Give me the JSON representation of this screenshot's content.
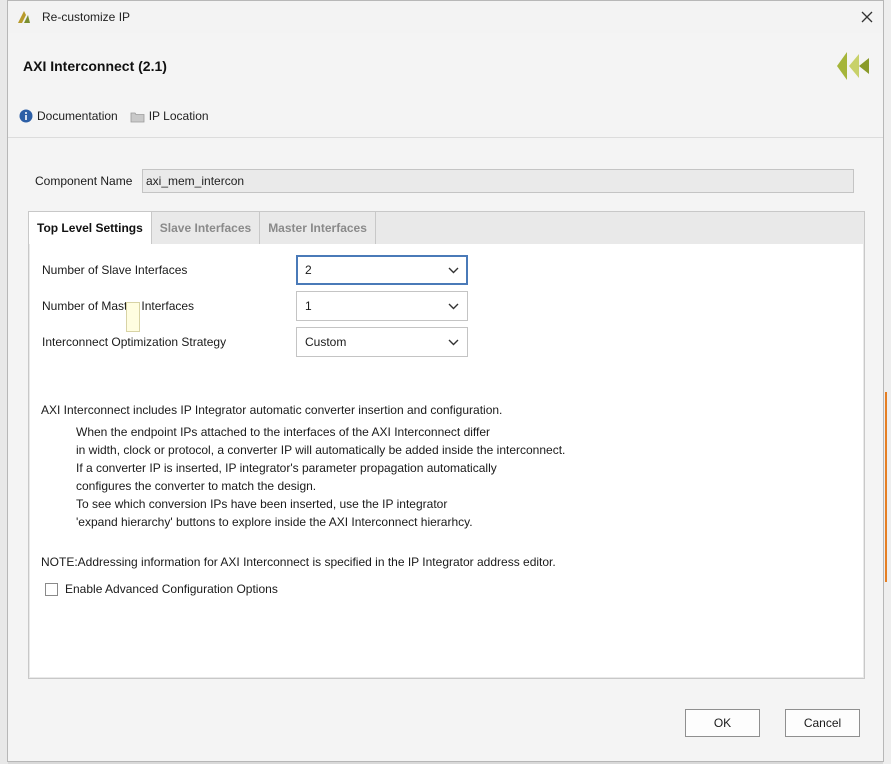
{
  "window": {
    "title": "Re-customize IP"
  },
  "header": {
    "ip_title": "AXI Interconnect (2.1)",
    "links": [
      {
        "label": "Documentation",
        "icon": "info-icon"
      },
      {
        "label": "IP Location",
        "icon": "folder-icon"
      }
    ]
  },
  "component": {
    "label": "Component Name",
    "value": "axi_mem_intercon"
  },
  "tabs": [
    {
      "label": "Top Level Settings",
      "active": true
    },
    {
      "label": "Slave Interfaces",
      "active": false
    },
    {
      "label": "Master Interfaces",
      "active": false
    }
  ],
  "params": [
    {
      "label": "Number of Slave Interfaces",
      "value": "2"
    },
    {
      "label": "Number of Master Interfaces",
      "value": "1"
    },
    {
      "label": "Interconnect Optimization Strategy",
      "value": "Custom"
    }
  ],
  "description": {
    "intro": "AXI Interconnect includes IP Integrator automatic converter insertion and configuration.",
    "lines": [
      "When the endpoint IPs attached to the interfaces of the AXI Interconnect differ",
      "in width, clock or protocol, a converter IP will automatically be added inside the interconnect.",
      "If a converter IP is inserted, IP integrator's parameter propagation automatically",
      "configures the converter to match the design.",
      "To see which conversion IPs have been inserted, use the IP integrator",
      "'expand hierarchy' buttons to explore inside the AXI Interconnect hierarhcy."
    ],
    "note": "NOTE:Addressing information for AXI Interconnect is specified in the IP Integrator address editor."
  },
  "advanced": {
    "label": "Enable Advanced Configuration Options",
    "checked": false
  },
  "buttons": {
    "ok": "OK",
    "cancel": "Cancel"
  },
  "colors": {
    "accent": "#4a7ab8",
    "brand": "#a5b53a",
    "info": "#2d5fa6"
  }
}
